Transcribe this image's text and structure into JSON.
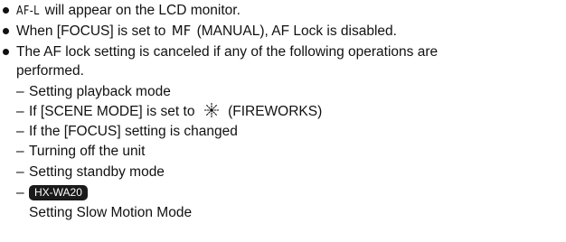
{
  "bullets": [
    {
      "lcd_indicator": "AF-L",
      "text": " will appear on the LCD monitor."
    },
    {
      "text_before": "When [FOCUS] is set to ",
      "lcd_indicator": "MF",
      "text_after": " (MANUAL), AF Lock is disabled."
    },
    {
      "line1": "The AF lock setting is canceled if any of the following operations are",
      "line2": "performed.",
      "items": [
        {
          "text": "Setting playback mode"
        },
        {
          "text_before": "If [SCENE MODE] is set to ",
          "icon": "fireworks-icon",
          "text_after": " (FIREWORKS)"
        },
        {
          "text": "If the [FOCUS] setting is changed"
        },
        {
          "text": "Turning off the unit"
        },
        {
          "text": "Setting standby mode"
        },
        {
          "badge": "HX-WA20",
          "continuation": "Setting Slow Motion Mode"
        }
      ]
    }
  ],
  "dash_char": "–"
}
